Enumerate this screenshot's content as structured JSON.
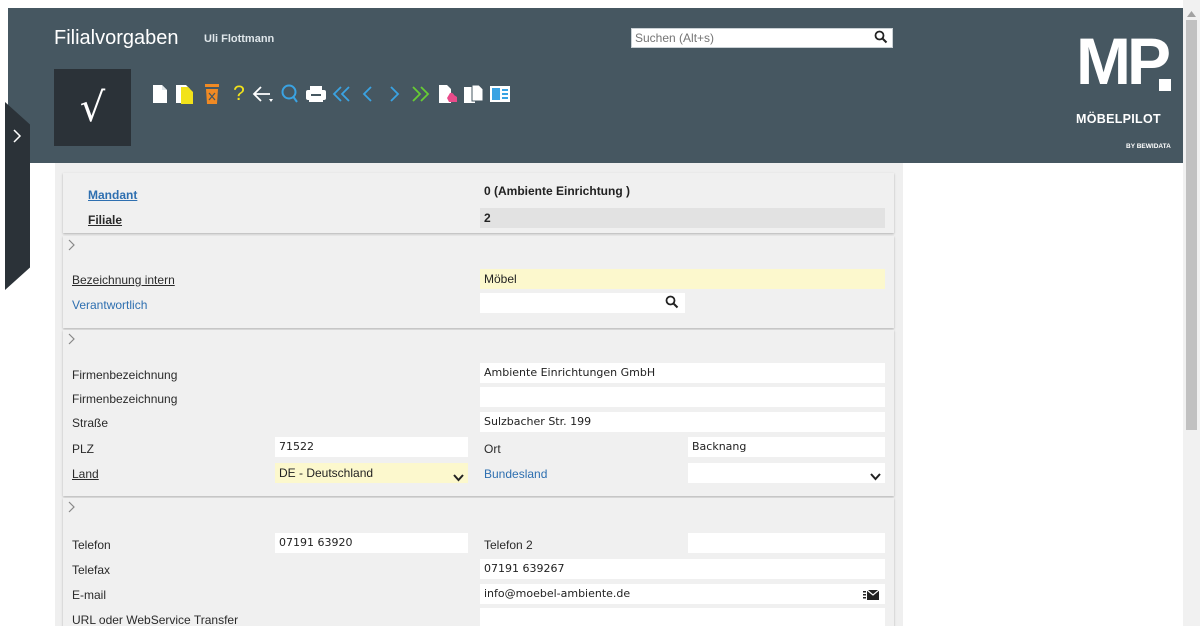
{
  "header": {
    "title": "Filialvorgaben",
    "user": "Uli Flottmann",
    "search_placeholder": "Suchen (Alt+s)",
    "confirm_symbol": "√",
    "help_symbol": "?",
    "toolbar_icons": [
      "new-document-icon",
      "copy-document-icon",
      "delete-icon",
      "help-icon",
      "back-icon",
      "find-icon",
      "print-icon",
      "first-record-icon",
      "previous-record-icon",
      "next-record-icon",
      "last-record-icon",
      "touch-document-icon",
      "duplicate-icon",
      "address-card-icon"
    ]
  },
  "logo": {
    "letters": "MP",
    "name": "MÖBELPILOT",
    "byline": "BY BEWIDATA"
  },
  "colors": {
    "header_bg": "#465761",
    "dark_button": "#2b3238",
    "link": "#2e6fb0",
    "highlight_field": "#fcf8cd",
    "accent_icon": "#3aa3e3",
    "yellow_icon": "#f2e21a",
    "orange_icon": "#f08a24"
  },
  "key_section": {
    "mandant_label": "Mandant",
    "mandant_value": "0 (Ambiente Einrichtung )",
    "filiale_label": "Filiale",
    "filiale_value": "2"
  },
  "section1": {
    "bezeichnung_label": "Bezeichnung intern",
    "bezeichnung_value": "Möbel",
    "verantwortlich_label": "Verantwortlich",
    "verantwortlich_value": ""
  },
  "section2": {
    "firma1_label": "Firmenbezeichnung",
    "firma1_value": "Ambiente Einrichtungen GmbH",
    "firma2_label": "Firmenbezeichnung",
    "firma2_value": "",
    "strasse_label": "Straße",
    "strasse_value": "Sulzbacher Str. 199",
    "plz_label": "PLZ",
    "plz_value": "71522",
    "ort_label": "Ort",
    "ort_value": "Backnang",
    "land_label": "Land",
    "land_value": "DE - Deutschland",
    "bundesland_label": "Bundesland",
    "bundesland_value": ""
  },
  "section3": {
    "telefon_label": "Telefon",
    "telefon_value": "07191 63920",
    "telefon2_label": "Telefon 2",
    "telefon2_value": "",
    "telefax_label": "Telefax",
    "telefax_value": "07191 639267",
    "email_label": "E-mail",
    "email_value": "info@moebel-ambiente.de",
    "url_label": "URL oder WebService Transfer",
    "url_value": ""
  }
}
